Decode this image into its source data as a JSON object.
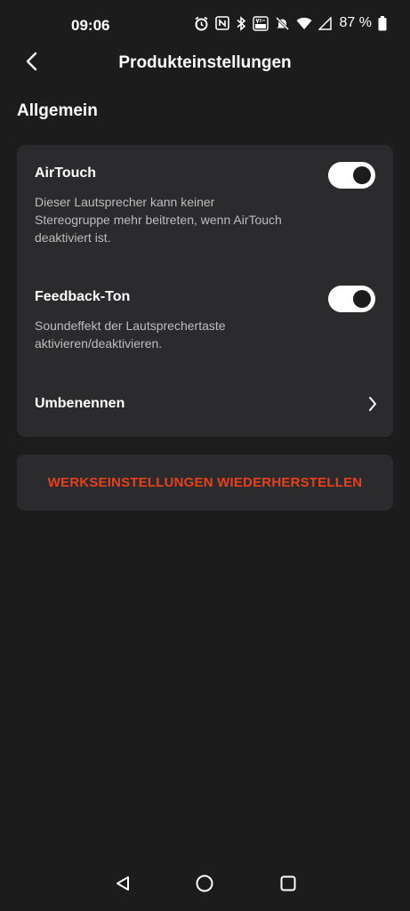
{
  "status_bar": {
    "time": "09:06",
    "icons": [
      "alarm-icon",
      "nfc-icon",
      "bluetooth-icon",
      "volte-icon",
      "mute-icon",
      "wifi-icon",
      "signal-icon",
      "battery-icon"
    ],
    "battery_percent": "87 %"
  },
  "app_bar": {
    "back_icon": "chevron-left-icon",
    "title": "Produkteinstellungen"
  },
  "section": {
    "title": "Allgemein"
  },
  "settings": [
    {
      "label": "AirTouch",
      "description": "Dieser Lautsprecher kann keiner Stereogruppe mehr beitreten, wenn AirTouch deaktiviert ist.",
      "enabled": true
    },
    {
      "label": "Feedback-Ton",
      "description": "Soundeffekt der Lautsprechertaste aktivieren/deaktivieren.",
      "enabled": true
    }
  ],
  "rename": {
    "label": "Umbenennen",
    "icon": "chevron-right-icon"
  },
  "reset": {
    "label": "WERKSEINSTELLUNGEN WIEDERHERSTELLEN"
  },
  "nav": {
    "back_icon": "triangle-back-icon",
    "home_icon": "circle-home-icon",
    "recents_icon": "square-recents-icon"
  },
  "colors": {
    "background": "#1c1c1c",
    "card": "#2b2b2d",
    "accent_danger": "#e6401c",
    "description_text": "#bdbdbd"
  }
}
